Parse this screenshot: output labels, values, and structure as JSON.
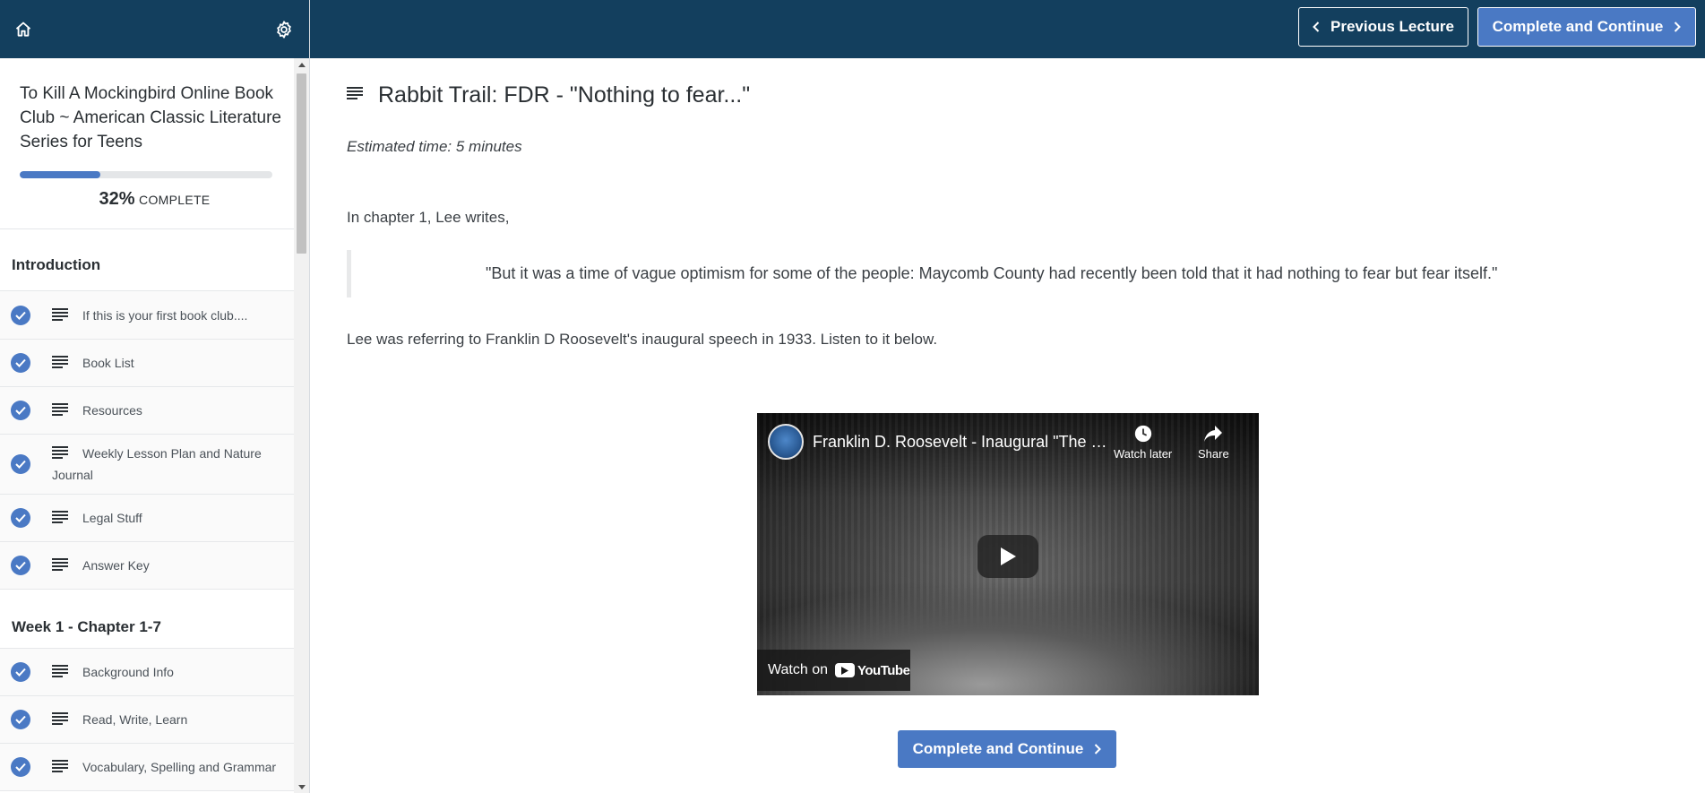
{
  "sidebar": {
    "course_title": "To Kill A Mockingbird Online Book Club ~ American Classic Literature Series for Teens",
    "progress_percent": 32,
    "progress_pct_label": "32%",
    "progress_complete_label": "COMPLETE",
    "sections": [
      {
        "title": "Introduction",
        "lectures": [
          {
            "label": "If this is your first book club....",
            "completed": true
          },
          {
            "label": "Book List",
            "completed": true
          },
          {
            "label": "Resources",
            "completed": true
          },
          {
            "label": "Weekly Lesson Plan and Nature Journal",
            "completed": true
          },
          {
            "label": "Legal Stuff",
            "completed": true
          },
          {
            "label": "Answer Key",
            "completed": true
          }
        ]
      },
      {
        "title": "Week 1 - Chapter 1-7",
        "lectures": [
          {
            "label": "Background Info",
            "completed": true
          },
          {
            "label": "Read, Write, Learn",
            "completed": true
          },
          {
            "label": "Vocabulary, Spelling and Grammar",
            "completed": true
          }
        ]
      }
    ]
  },
  "topbar": {
    "prev_label": "Previous Lecture",
    "next_label": "Complete and Continue"
  },
  "lecture": {
    "title": "Rabbit Trail: FDR - \"Nothing to fear...\"",
    "estimated_time": "Estimated time: 5 minutes",
    "paragraph1": "In chapter 1, Lee writes,",
    "quote": "\"But it was a time of vague optimism for some of the people: Maycomb County had recently been told that it had nothing to fear but fear itself.\"",
    "paragraph2": "Lee was referring to Franklin D Roosevelt's inaugural speech in 1933. Listen to it below."
  },
  "video": {
    "title": "Franklin D. Roosevelt - Inaugural \"The O...",
    "watch_later_label": "Watch later",
    "share_label": "Share",
    "watch_on_label": "Watch on",
    "youtube_label": "YouTube"
  },
  "bottom": {
    "complete_label": "Complete and Continue"
  },
  "colors": {
    "nav_bg": "#133f5e",
    "accent": "#4a79c4"
  }
}
